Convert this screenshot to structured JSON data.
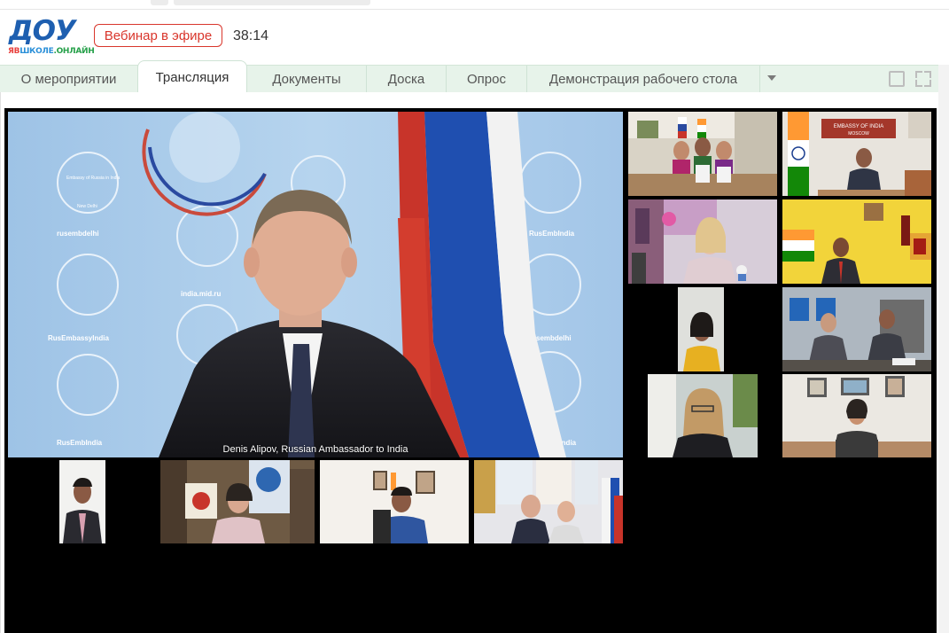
{
  "header": {
    "logo_word": "ДОУ",
    "logo_sub": {
      "a": "ЯВ",
      "b": "ШКОЛЕ",
      "c": ".ОНЛАЙН"
    },
    "live_badge": "Вебинар в эфире",
    "timer": "38:14"
  },
  "tabs": [
    {
      "label": "О мероприятии"
    },
    {
      "label": "Трансляция"
    },
    {
      "label": "Документы"
    },
    {
      "label": "Доска"
    },
    {
      "label": "Опрос"
    },
    {
      "label": "Демонстрация рабочего стола"
    }
  ],
  "active_tab": "Трансляция",
  "icons": {
    "more": "chevron-down-icon",
    "single_view": "single-window-icon",
    "fullscreen": "fullscreen-icon"
  },
  "video": {
    "main_caption": "Denis Alipov, Russian Ambassador to India",
    "backdrop_text": {
      "vk": "rusembdelhi",
      "site": "india.mid.ru",
      "fb": "RusEmbassyIndia",
      "tw": "RusEmbIndia",
      "emblem": "Embassy of Russia in India",
      "city": "New Delhi",
      "vk2": "RusEmbIndia",
      "ig": "rusembdelhi",
      "tw2": "RusEmbIndia"
    },
    "sign_text": {
      "embassy_line1": "EMBASSY OF INDIA",
      "embassy_line2": "MOSCOW"
    }
  },
  "colors": {
    "brand_blue": "#1e5fb0",
    "live_red": "#d9362c",
    "tab_bg": "#e7f3ea",
    "stage": "#000000"
  }
}
